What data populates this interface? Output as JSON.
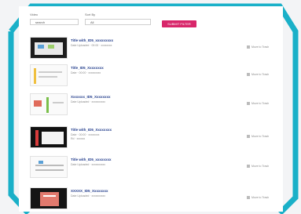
{
  "filters": {
    "field1_label": "Video",
    "field1_value": "search",
    "field2_label": "Sort By",
    "field2_value": "All",
    "submit_label": "SUBMIT FILTER"
  },
  "rows": [
    {
      "title": "Title with_ID5_xxxxxxxxx",
      "meta": "Date Uploaded · 00:00 · xxxxxxxx",
      "meta2": "",
      "action": "Move to Trash"
    },
    {
      "title": "Title_ID5_Xxxxxxxx",
      "meta": "Date · 00:00 · xxxxxxxxx",
      "meta2": "",
      "action": "Move to Trash"
    },
    {
      "title": "Xxxxxxx_ID5_Xxxxxxxx",
      "meta": "Date Uploaded · xxxxxxxxxx",
      "meta2": "",
      "action": "Move to Trash"
    },
    {
      "title": "Title with_ID5_Xxxxxxxx",
      "meta": "Date · 00:00 · xxxxxxxx",
      "meta2": "Rd · xxxxxx",
      "action": "Move to Trash"
    },
    {
      "title": "Title with_ID5_xxxxxxxx",
      "meta": "Date Uploaded · xxxxxxxxxx",
      "meta2": "",
      "action": "Move to Trash"
    },
    {
      "title": "XXXXX_ID5_Xxxxxxxx",
      "meta": "Date Uploaded · xxxxxxxxxx",
      "meta2": "",
      "action": "Move to Trash"
    }
  ]
}
